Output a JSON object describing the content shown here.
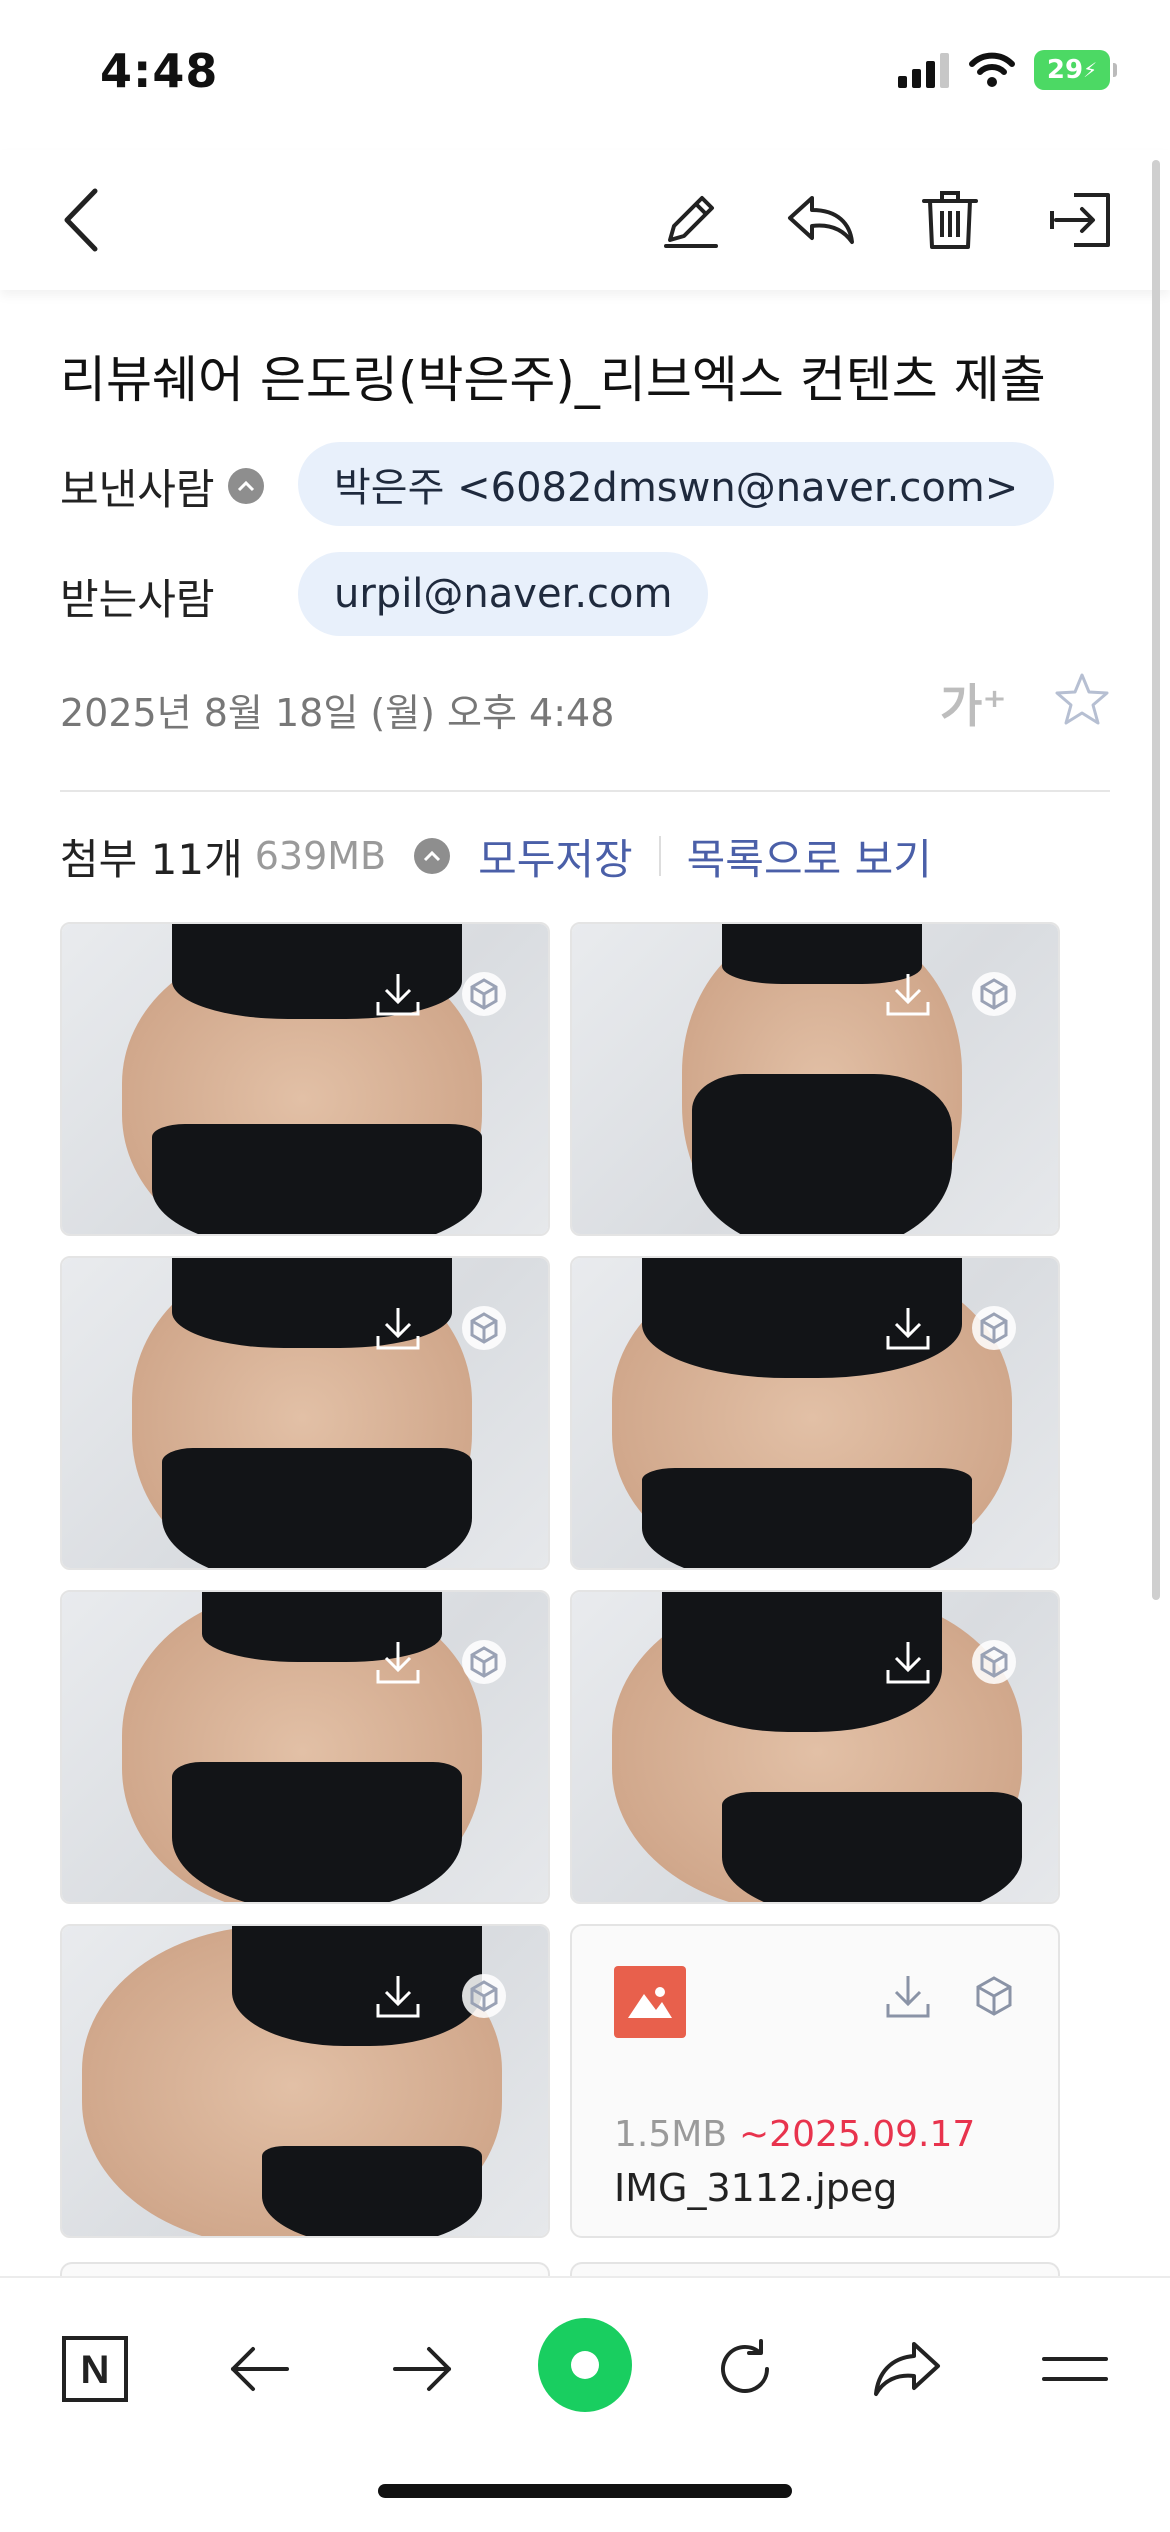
{
  "status_bar": {
    "time": "4:48",
    "battery": "29"
  },
  "toolbar": {
    "back": "back",
    "edit": "edit",
    "reply": "reply",
    "delete": "delete",
    "move": "move"
  },
  "mail": {
    "subject": "리뷰쉐어 은도링(박은주)_리브엑스 컨텐츠 제출",
    "sender_label": "보낸사람",
    "sender": "박은주 <6082dmswn@naver.com>",
    "recipient_label": "받는사람",
    "recipient": "urpil@naver.com",
    "date": "2025년 8월 18일 (월) 오후 4:48",
    "font_size_label": "가⁺"
  },
  "attachments": {
    "title": "첨부 11개",
    "size": "639MB",
    "save_all": "모두저장",
    "view_list": "목록으로 보기",
    "file_card": {
      "size": "1.5MB",
      "expire": "~2025.09.17",
      "name": "IMG_3112.jpeg"
    }
  },
  "icons": {
    "download": "download-icon",
    "mybox": "cube-icon",
    "naver": "naver-n-icon",
    "accent_green": "#19ce60",
    "link_color": "#4a5fa8",
    "expire_color": "#e8334d"
  },
  "bottom_nav": {
    "home": "N"
  }
}
